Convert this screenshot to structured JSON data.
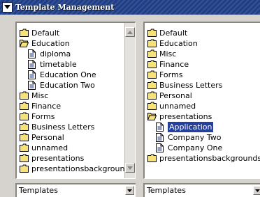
{
  "window": {
    "title": "Template Management"
  },
  "left_tree": {
    "items": [
      {
        "label": "Default",
        "icon": "folder-icon",
        "level": 0
      },
      {
        "label": "Education",
        "icon": "folder-open-icon",
        "level": 0
      },
      {
        "label": "diploma",
        "icon": "document-icon",
        "level": 1
      },
      {
        "label": "timetable",
        "icon": "document-icon",
        "level": 1
      },
      {
        "label": "Education One",
        "icon": "document-icon",
        "level": 1
      },
      {
        "label": "Education Two",
        "icon": "document-icon",
        "level": 1
      },
      {
        "label": "Misc",
        "icon": "folder-icon",
        "level": 0
      },
      {
        "label": "Finance",
        "icon": "folder-icon",
        "level": 0
      },
      {
        "label": "Forms",
        "icon": "folder-icon",
        "level": 0
      },
      {
        "label": "Business Letters",
        "icon": "folder-icon",
        "level": 0
      },
      {
        "label": "Personal",
        "icon": "folder-icon",
        "level": 0
      },
      {
        "label": "unnamed",
        "icon": "folder-icon",
        "level": 0
      },
      {
        "label": "presentations",
        "icon": "folder-icon",
        "level": 0
      },
      {
        "label": "presentationsbackgrounds",
        "icon": "folder-icon",
        "level": 0
      }
    ]
  },
  "right_tree": {
    "items": [
      {
        "label": "Default",
        "icon": "folder-icon",
        "level": 0
      },
      {
        "label": "Education",
        "icon": "folder-icon",
        "level": 0
      },
      {
        "label": "Misc",
        "icon": "folder-icon",
        "level": 0
      },
      {
        "label": "Finance",
        "icon": "folder-icon",
        "level": 0
      },
      {
        "label": "Forms",
        "icon": "folder-icon",
        "level": 0
      },
      {
        "label": "Business Letters",
        "icon": "folder-icon",
        "level": 0
      },
      {
        "label": "Personal",
        "icon": "folder-icon",
        "level": 0
      },
      {
        "label": "unnamed",
        "icon": "folder-icon",
        "level": 0
      },
      {
        "label": "presentations",
        "icon": "folder-open-icon",
        "level": 0
      },
      {
        "label": "Application",
        "icon": "document-icon",
        "level": 1,
        "selected": true
      },
      {
        "label": "Company Two",
        "icon": "document-icon",
        "level": 1
      },
      {
        "label": "Company One",
        "icon": "document-icon",
        "level": 1
      },
      {
        "label": "presentationsbackgrounds",
        "icon": "folder-icon",
        "level": 0
      }
    ]
  },
  "left_combo": {
    "value": "Templates"
  },
  "right_combo": {
    "value": "Templates"
  },
  "colors": {
    "titlebar": "#1f3e86",
    "selection": "#243f9c",
    "folder": "#f6e27a",
    "background": "#d6d3ce"
  }
}
